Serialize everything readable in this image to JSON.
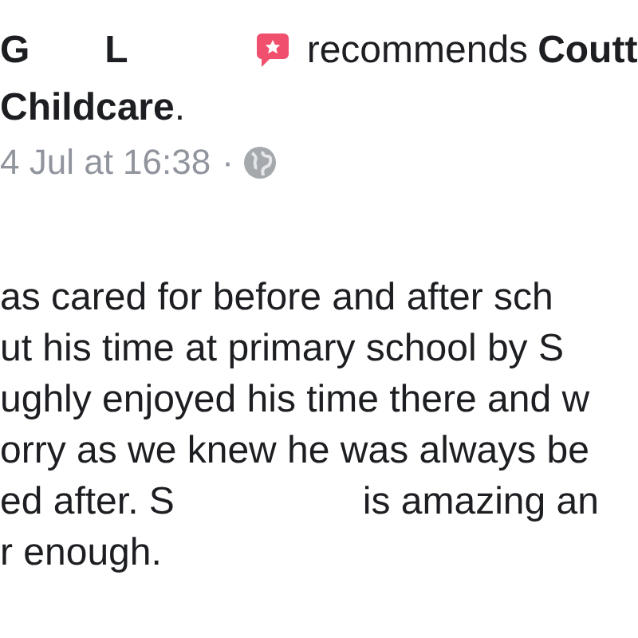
{
  "post": {
    "header": {
      "author_parts": [
        "G",
        "L"
      ],
      "verb": "recommends",
      "page_name": "Coutt",
      "page_name_cont": "Childcare",
      "end_mark": "."
    },
    "meta": {
      "timestamp": "4 Jul at 16:38",
      "separator": "·"
    },
    "body_lines": [
      {
        "segments": [
          "as cared for before and after sch"
        ]
      },
      {
        "segments": [
          "ut his time at primary school by S"
        ]
      },
      {
        "segments": [
          "ughly enjoyed his time there and w"
        ]
      },
      {
        "segments": [
          "orry as we knew he was always be"
        ]
      },
      {
        "segments": [
          "ed after. S",
          "is amazing an"
        ]
      },
      {
        "segments": [
          "r enough."
        ]
      }
    ]
  }
}
